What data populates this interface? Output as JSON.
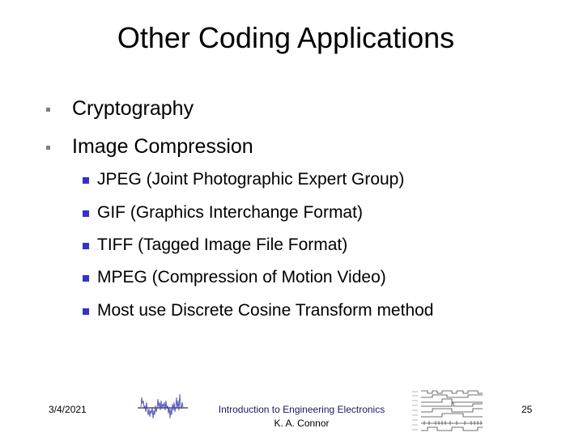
{
  "slide": {
    "title": "Other Coding Applications",
    "bullets": [
      {
        "text": "Cryptography"
      },
      {
        "text": "Image Compression",
        "sub_bullets": [
          {
            "text": "JPEG (Joint Photographic Expert Group)"
          },
          {
            "text": "GIF (Graphics Interchange Format)"
          },
          {
            "text": "TIFF (Tagged Image File Format)"
          },
          {
            "text": "MPEG (Compression of Motion Video)"
          },
          {
            "text": "Most use Discrete Cosine Transform method"
          }
        ]
      }
    ],
    "colors": {
      "sub_bullet": "#3333cc",
      "main_bullet": "#808080",
      "noise_signal": "#4444aa"
    }
  },
  "footer": {
    "date": "3/4/2021",
    "course": "Introduction to Engineering Electronics",
    "author": "K. A. Connor",
    "page_number": "25",
    "left_graphic": "noise-signal-icon",
    "right_graphic": "timing-diagram-icon"
  }
}
